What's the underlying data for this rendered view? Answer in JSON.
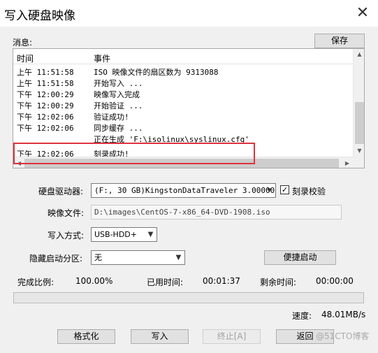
{
  "window": {
    "title": "写入硬盘映像",
    "close_glyph": "✕"
  },
  "messages": {
    "label": "消息:",
    "save_button": "保存",
    "columns": [
      "时间",
      "事件"
    ],
    "rows": [
      {
        "time": "上午 11:51:58",
        "event": "ISO 映像文件的扇区数为 9313088"
      },
      {
        "time": "上午 11:51:58",
        "event": "开始写入 ..."
      },
      {
        "time": "下午 12:00:29",
        "event": "映像写入完成"
      },
      {
        "time": "下午 12:00:29",
        "event": "开始验证 ..."
      },
      {
        "time": "下午 12:02:06",
        "event": "验证成功!"
      },
      {
        "time": "下午 12:02:06",
        "event": "同步缓存 ..."
      },
      {
        "time": "",
        "event": "正在生成 'F:\\isolinux\\syslinux.cfg'"
      },
      {
        "time": "下午 12:02:06",
        "event": "刻录成功!"
      }
    ]
  },
  "form": {
    "drive_label": "硬盘驱动器:",
    "drive_value": "(F:, 30 GB)KingstonDataTraveler 3.00000",
    "verify_label": "刻录校验",
    "verify_checked": true,
    "image_label": "映像文件:",
    "image_value": "D:\\images\\CentOS-7-x86_64-DVD-1908.iso",
    "mode_label": "写入方式:",
    "mode_value": "USB-HDD+",
    "hidden_label": "隐藏启动分区:",
    "hidden_value": "无",
    "quick_boot_button": "便捷启动"
  },
  "status": {
    "progress_label": "完成比例:",
    "progress_value": "100.00%",
    "progress_fraction": 1.0,
    "elapsed_label": "已用时间:",
    "elapsed_value": "00:01:37",
    "remaining_label": "剩余时间:",
    "remaining_value": "00:00:00",
    "speed_label": "速度:",
    "speed_value": "48.01MB/s"
  },
  "buttons": {
    "format": "格式化",
    "write": "写入",
    "stop": "终止[A]",
    "back": "返回"
  },
  "watermark": "@51CTO博客",
  "colors": {
    "progress_fill": "#06b025",
    "highlight": "#e0323e"
  }
}
